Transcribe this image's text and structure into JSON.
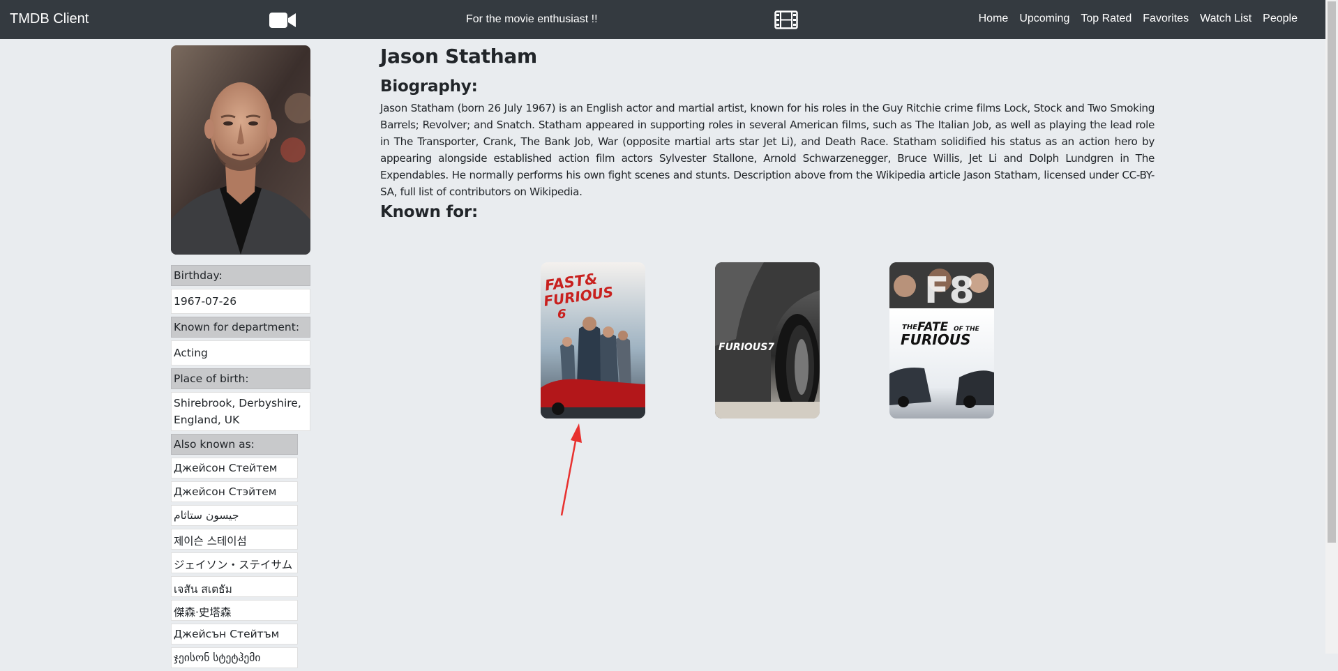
{
  "navbar": {
    "brand": "TMDB Client",
    "camera_icon": "video-camera-icon",
    "tagline": "For the movie enthusiast !!",
    "film_icon": "film-strip-icon",
    "links": [
      "Home",
      "Upcoming",
      "Top Rated",
      "Favorites",
      "Watch List",
      "People"
    ]
  },
  "person": {
    "name": "Jason Statham",
    "birthday_label": "Birthday:",
    "birthday": "1967-07-26",
    "department_label": "Known for department:",
    "department": "Acting",
    "birthplace_label": "Place of birth:",
    "birthplace": "Shirebrook, Derbyshire, England, UK",
    "aka_label": "Also known as:",
    "aka": [
      "Джейсон Стейтем",
      "Джейсон Стэйтем",
      "جيسون ستاثام",
      "제이슨 스테이섬",
      "ジェイソン・ステイサム",
      "เจสัน สเตธัม",
      "傑森·史塔森",
      "Джейсън Стейтъм",
      "ჯეისონ სტეტჰემი"
    ]
  },
  "main": {
    "biography_heading": "Biography:",
    "biography": "Jason Statham (born 26 July 1967) is an English actor and martial artist, known for his roles in the Guy Ritchie crime films Lock, Stock and Two Smoking Barrels; Revolver; and Snatch. Statham appeared in supporting roles in several American films, such as The Italian Job, as well as playing the lead role in The Transporter, Crank, The Bank Job, War (opposite martial arts star Jet Li), and Death Race. Statham solidified his status as an action hero by appearing alongside established action film actors Sylvester Stallone, Arnold Schwarzenegger, Bruce Willis, Jet Li and Dolph Lundgren in The Expendables. He normally performs his own fight scenes and stunts. Description above from the Wikipedia article Jason Statham, licensed under CC-BY-SA, full list of contributors on Wikipedia.",
    "known_for_heading": "Known for:"
  },
  "posters": {
    "p1_line1": "FAST&",
    "p1_line2": "FURIOUS",
    "p1_line3": "6",
    "p2_title": "FURIOUS7",
    "p3_line1": "F8",
    "p3_line2": "THE",
    "p3_line3": "FATE",
    "p3_line4": "OF THE",
    "p3_line5": "FURIOUS"
  },
  "colors": {
    "navbar": "#343a40",
    "page_bg": "#e9ecef",
    "label_bg": "#c8c9cb",
    "annotation_arrow": "#e8312f"
  }
}
